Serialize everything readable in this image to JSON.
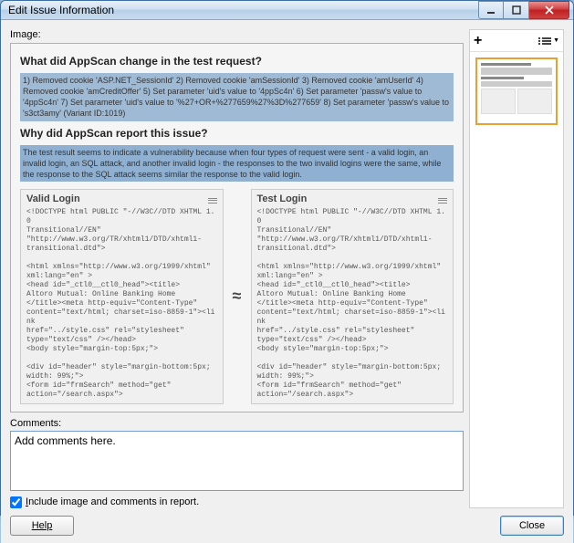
{
  "window": {
    "title": "Edit Issue Information"
  },
  "labels": {
    "image": "Image:",
    "comments": "Comments:",
    "include_before": "Include image and comments in report.",
    "include_underline_char": "I"
  },
  "comments": {
    "value": "Add comments here."
  },
  "checkbox": {
    "checked": true
  },
  "buttons": {
    "help": "Help",
    "close": "Close"
  },
  "sidebar": {
    "add_tooltip": "Add",
    "view_tooltip": "View"
  },
  "preview": {
    "q1": "What did AppScan change in the test request?",
    "block1": "1) Removed cookie 'ASP.NET_SessionId' 2) Removed cookie 'amSessionId' 3) Removed cookie 'amUserId' 4) Removed cookie 'amCreditOffer' 5) Set parameter 'uid's value to '4ppSc4n' 6) Set parameter 'passw's value to '4ppSc4n' 7) Set parameter 'uid's value to '%27+OR+%277659%27%3D%277659' 8) Set parameter 'passw's value to 's3ct3amy' (Variant ID:1019)",
    "q2": "Why did AppScan report this issue?",
    "block2": "The test result seems to indicate a vulnerability because when four types of request were sent - a valid login, an invalid login, an SQL attack, and another invalid login - the responses to the two invalid logins were the same, while the response to the SQL attack seems similar the response to the valid login.",
    "col1_title": "Valid Login",
    "col2_title": "Test Login",
    "approx": "≈",
    "code1": "<!DOCTYPE html PUBLIC \"-//W3C//DTD XHTML 1.0\nTransitional//EN\"\n\"http://www.w3.org/TR/xhtml1/DTD/xhtml1-\ntransitional.dtd\">\n\n<html xmlns=\"http://www.w3.org/1999/xhtml\"\nxml:lang=\"en\" >\n<head id=\"_ctl0__ctl0_head\"><title>\nAltoro Mutual: Online Banking Home\n</title><meta http-equiv=\"Content-Type\"\ncontent=\"text/html; charset=iso-8859-1\"><link\nhref=\"../style.css\" rel=\"stylesheet\"\ntype=\"text/css\" /></head>\n<body style=\"margin-top:5px;\">\n\n<div id=\"header\" style=\"margin-bottom:5px;\nwidth: 99%;\">\n<form id=\"frmSearch\" method=\"get\"\naction=\"/search.aspx\">",
    "code2": "<!DOCTYPE html PUBLIC \"-//W3C//DTD XHTML 1.0\nTransitional//EN\"\n\"http://www.w3.org/TR/xhtml1/DTD/xhtml1-\ntransitional.dtd\">\n\n<html xmlns=\"http://www.w3.org/1999/xhtml\"\nxml:lang=\"en\" >\n<head id=\"_ctl0__ctl0_head\"><title>\nAltoro Mutual: Online Banking Home\n</title><meta http-equiv=\"Content-Type\"\ncontent=\"text/html; charset=iso-8859-1\"><link\nhref=\"../style.css\" rel=\"stylesheet\"\ntype=\"text/css\" /></head>\n<body style=\"margin-top:5px;\">\n\n<div id=\"header\" style=\"margin-bottom:5px;\nwidth: 99%;\">\n<form id=\"frmSearch\" method=\"get\"\naction=\"/search.aspx\">"
  }
}
